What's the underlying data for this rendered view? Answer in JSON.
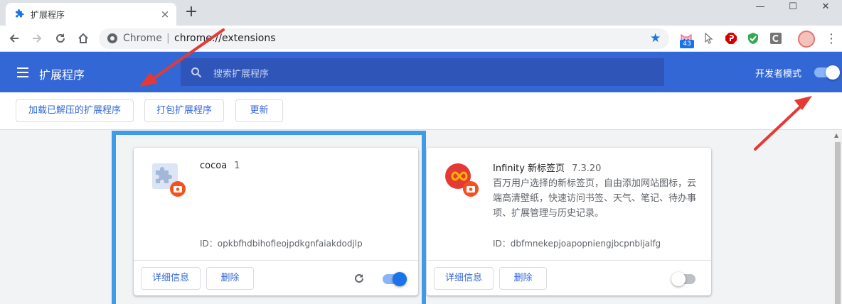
{
  "tab": {
    "title": "扩展程序",
    "close": "×",
    "new_tab": "+"
  },
  "window": {
    "minimize": "—",
    "maximize": "☐",
    "close": "✕"
  },
  "omnibox": {
    "scheme_label": "Chrome",
    "separator": "|",
    "url": "chrome://extensions"
  },
  "toolbar_extensions": [
    {
      "icon": "cat-extension-icon",
      "badge": "43",
      "color": "#f48fb1"
    },
    {
      "icon": "cursor-extension-icon",
      "color": "#9e9e9e"
    },
    {
      "icon": "stop-extension-icon",
      "color": "#d50000"
    },
    {
      "icon": "shield-check-extension-icon",
      "color": "#34a853"
    },
    {
      "icon": "c-extension-icon",
      "color": "#757575"
    }
  ],
  "header": {
    "title": "扩展程序",
    "search_placeholder": "搜索扩展程序",
    "dev_mode_label": "开发者模式",
    "dev_mode_on": true
  },
  "actions": {
    "load_unpacked": "加载已解压的扩展程序",
    "pack": "打包扩展程序",
    "update": "更新"
  },
  "extensions": [
    {
      "name": "cocoa",
      "version": "1",
      "description": "",
      "id_label": "ID：",
      "id": "opkbfhdbihofieojpdkgnfaiakdodjlp",
      "details_label": "详细信息",
      "remove_label": "删除",
      "enabled": true,
      "icon": "puzzle-piece-icon"
    },
    {
      "name": "Infinity 新标签页",
      "version": "7.3.20",
      "description": "百万用户选择的新标签页，自由添加网站图标，云端高清壁纸，快速访问书签、天气、笔记、待办事项、扩展管理与历史记录。",
      "id_label": "ID：",
      "id": "dbfmnekepjoapopniengjbcpnbljalfg",
      "details_label": "详细信息",
      "remove_label": "删除",
      "enabled": false,
      "icon": "infinity-icon"
    }
  ],
  "colors": {
    "header_blue": "#3367d6",
    "accent_blue": "#1a73e8",
    "annotation_red": "#e53935",
    "highlight_blue": "#3d9be9"
  }
}
